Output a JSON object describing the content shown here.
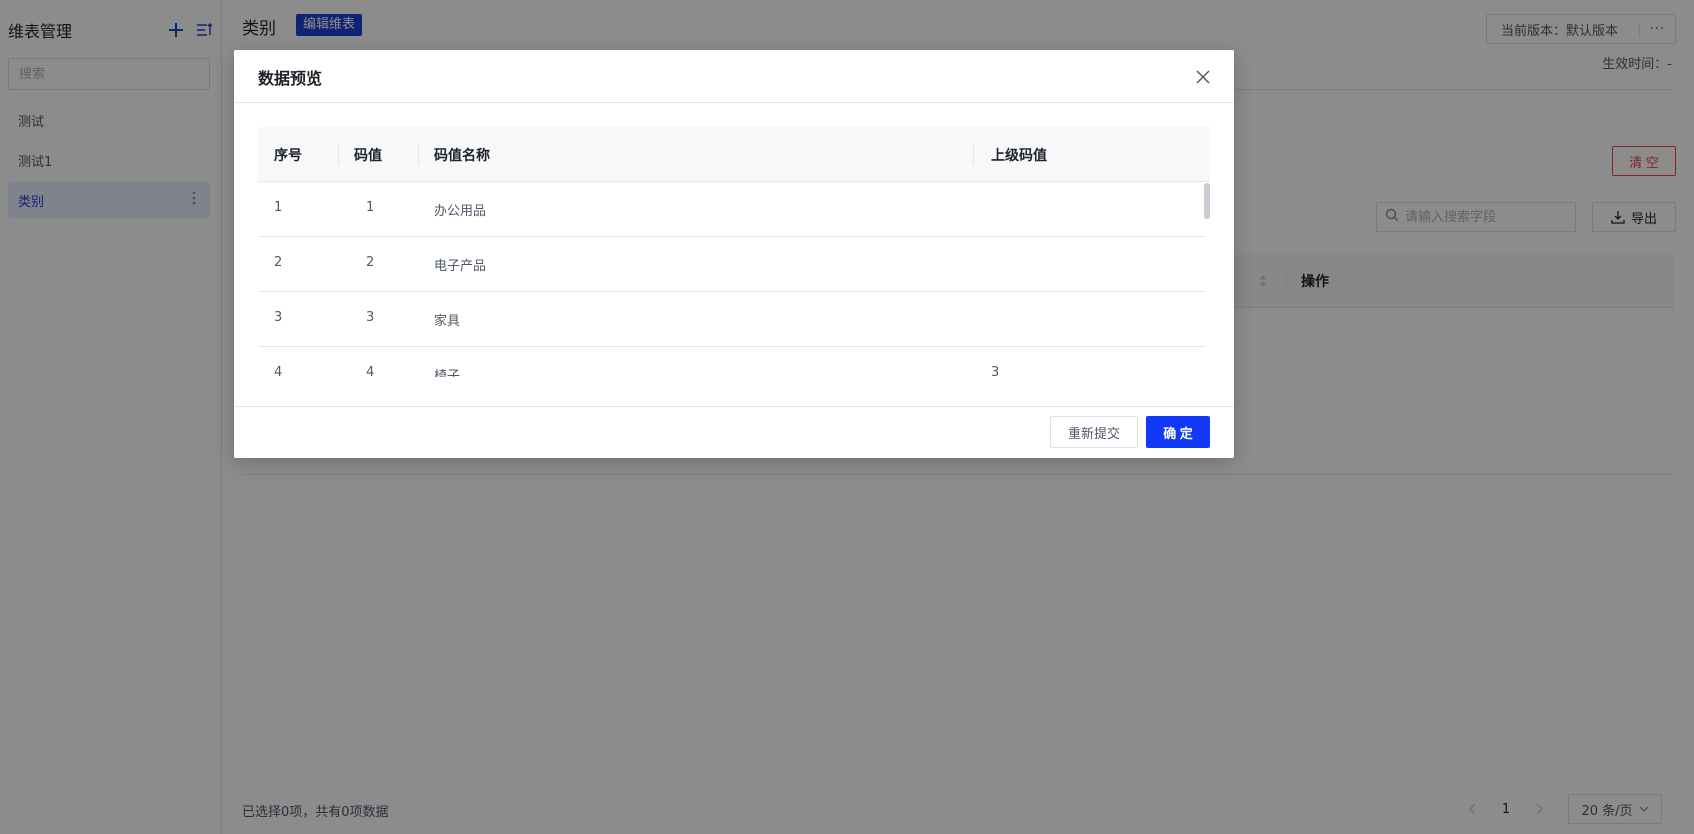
{
  "sidebar": {
    "title": "维表管理",
    "add_icon": "plus-icon",
    "sort_icon": "sort-list-icon",
    "search_placeholder": "搜索",
    "items": [
      {
        "label": "测试"
      },
      {
        "label": "测试1"
      },
      {
        "label": "类别",
        "active": true,
        "more_icon": "more-vertical-icon"
      }
    ]
  },
  "main": {
    "title": "类别",
    "badge": "编辑维表",
    "version_label": "当前版本：默认版本",
    "version_more": "···",
    "effective_time": "生效时间：-",
    "clear_label": "清 空",
    "search_placeholder": "请输入搜索字段",
    "export_label": "导出",
    "table_op_header": "操作",
    "selection_summary": "已选择0项，共有0项数据",
    "pagination": {
      "current_page": "1",
      "page_size": "20 条/页"
    }
  },
  "modal": {
    "title": "数据预览",
    "columns": [
      "序号",
      "码值",
      "码值名称",
      "上级码值"
    ],
    "rows": [
      {
        "index": "1",
        "code": "1",
        "name": "办公用品",
        "parent": ""
      },
      {
        "index": "2",
        "code": "2",
        "name": "电子产品",
        "parent": ""
      },
      {
        "index": "3",
        "code": "3",
        "name": "家具",
        "parent": ""
      },
      {
        "index": "4",
        "code": "4",
        "name": "椅子",
        "parent": "3"
      }
    ],
    "resubmit_label": "重新提交",
    "ok_label": "确 定"
  },
  "colors": {
    "primary": "#1239f5",
    "badge": "#1e3fd7",
    "danger": "#f53f3f",
    "overlay": "rgba(0,0,0,0.45)"
  }
}
